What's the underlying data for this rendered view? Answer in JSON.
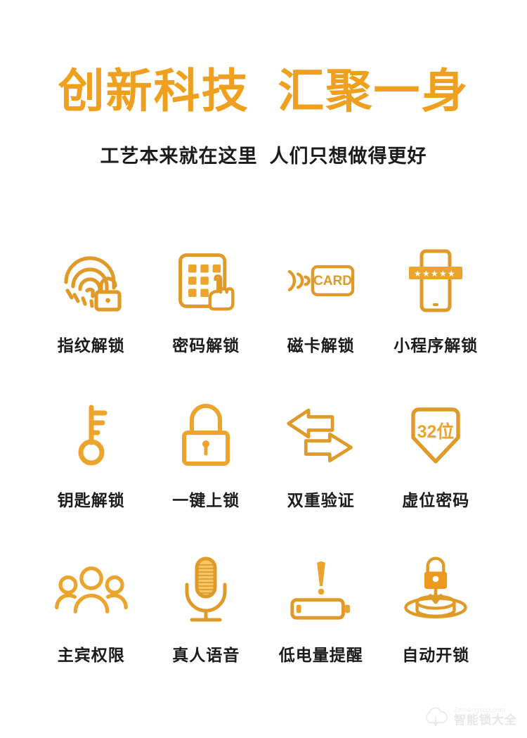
{
  "page": {
    "background_color": "#ffffff",
    "accent_color": "#efa01f",
    "icon_color": "#e09a28",
    "text_color": "#1b1b1b"
  },
  "header": {
    "main_title": "创新科技  汇聚一身",
    "subtitle": "工艺本来就在这里  人们只想做得更好"
  },
  "features": [
    {
      "icon": "fingerprint-unlock-icon",
      "label": "指纹解锁"
    },
    {
      "icon": "keypad-password-icon",
      "label": "密码解锁"
    },
    {
      "icon": "card-unlock-icon",
      "label": "磁卡解锁",
      "icon_text": "CARD"
    },
    {
      "icon": "mini-program-phone-icon",
      "label": "小程序解锁"
    },
    {
      "icon": "key-unlock-icon",
      "label": "钥匙解锁"
    },
    {
      "icon": "padlock-icon",
      "label": "一键上锁"
    },
    {
      "icon": "dual-arrows-icon",
      "label": "双重验证"
    },
    {
      "icon": "shield-32bit-icon",
      "label": "虚位密码",
      "icon_text": "32位"
    },
    {
      "icon": "user-group-icon",
      "label": "主宾权限"
    },
    {
      "icon": "microphone-icon",
      "label": "真人语音"
    },
    {
      "icon": "low-battery-alert-icon",
      "label": "低电量提醒"
    },
    {
      "icon": "auto-unlock-icon",
      "label": "自动开锁"
    }
  ],
  "watermark": {
    "line1": "Zhinengsuo.com",
    "line2": "智能锁大全"
  }
}
